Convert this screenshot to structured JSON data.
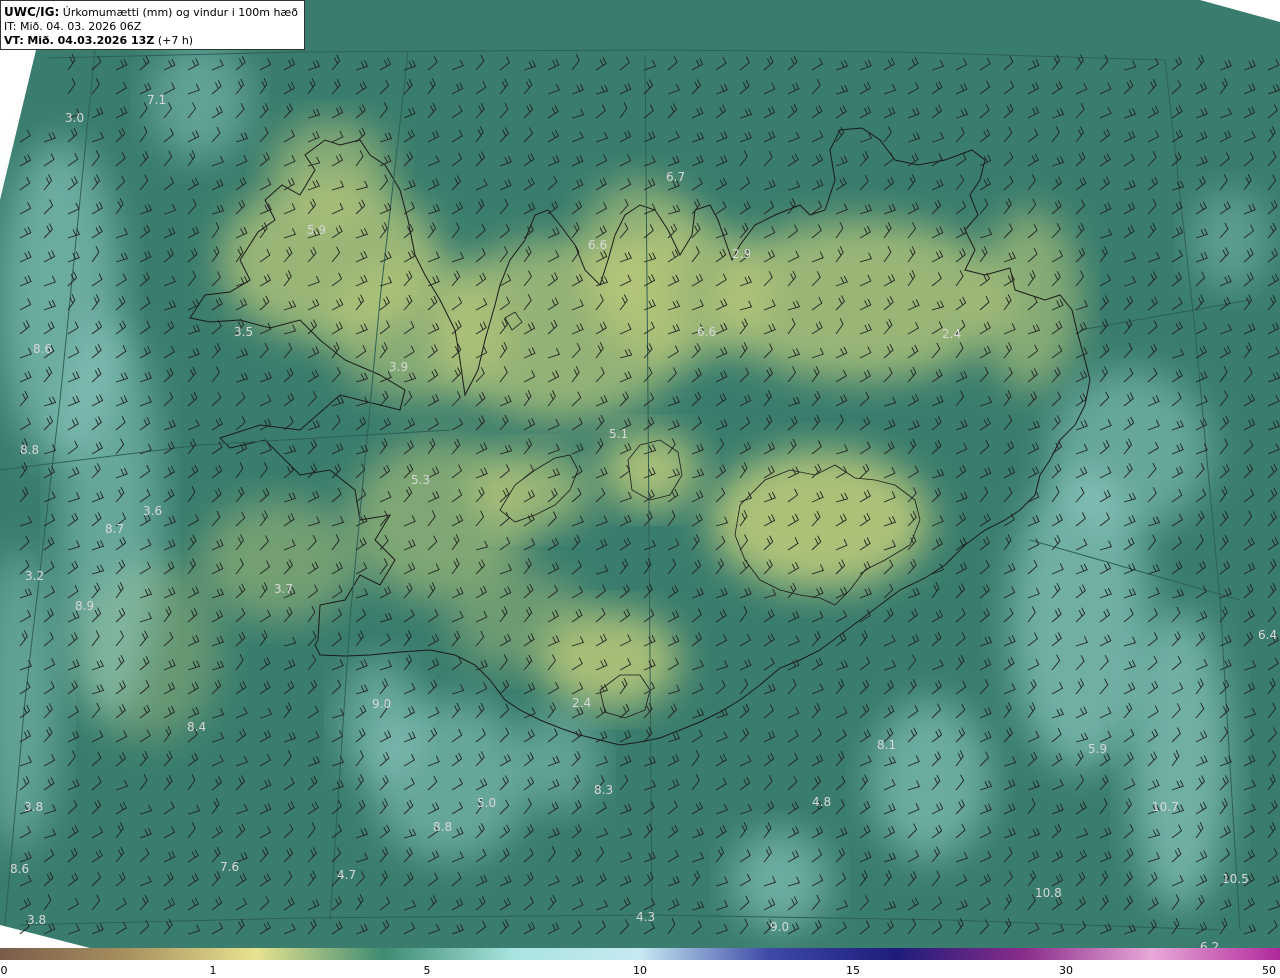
{
  "title": {
    "product": "UWC/IG:",
    "description": "Úrkomumætti (mm) og vindur i 100m hæð",
    "it_line": "IT: Mið. 04. 03. 2026 06Z",
    "vt_label": "VT:",
    "vt_value": "Mið. 04.03.2026 13Z",
    "vt_offset": "(+7 h)"
  },
  "colors": {
    "ocean_base": "#3a7d6e",
    "land_yellow": "#b9c97a",
    "light_cyan": "#9fd9d3",
    "coastline": "#1a1a1a"
  },
  "value_labels": [
    {
      "text": "7.1"
    },
    {
      "text": "3.0"
    },
    {
      "text": "6.7"
    },
    {
      "text": "5.9"
    },
    {
      "text": "6.6"
    },
    {
      "text": "2.9"
    },
    {
      "text": "3.5"
    },
    {
      "text": "8.6"
    },
    {
      "text": "6.6"
    },
    {
      "text": "2.4"
    },
    {
      "text": "3.9"
    },
    {
      "text": "5.1"
    },
    {
      "text": "8.8"
    },
    {
      "text": "5.3"
    },
    {
      "text": "3.6"
    },
    {
      "text": "8.7"
    },
    {
      "text": "3.2"
    },
    {
      "text": "3.7"
    },
    {
      "text": "8.9"
    },
    {
      "text": "6.4"
    },
    {
      "text": "9.0"
    },
    {
      "text": "8.4"
    },
    {
      "text": "2.4"
    },
    {
      "text": "5.9"
    },
    {
      "text": "8.1"
    },
    {
      "text": "3.8"
    },
    {
      "text": "5.0"
    },
    {
      "text": "8.3"
    },
    {
      "text": "4.8"
    },
    {
      "text": "10.7"
    },
    {
      "text": "8.8"
    },
    {
      "text": "8.6"
    },
    {
      "text": "7.6"
    },
    {
      "text": "4.7"
    },
    {
      "text": "10.8"
    },
    {
      "text": "10.5"
    },
    {
      "text": "3.8"
    },
    {
      "text": "4.3"
    },
    {
      "text": "9.0"
    },
    {
      "text": "6.2"
    }
  ],
  "colorbar": {
    "ticks": [
      "0",
      "1",
      "5",
      "10",
      "15",
      "30",
      "50"
    ],
    "colors": [
      "#7a5c4a",
      "#a8915f",
      "#e7e38f",
      "#3d8b72",
      "#a9e4df",
      "#c6e9f2",
      "#3f4aa8",
      "#1d1c7a",
      "#8a2c8a",
      "#e8a8d8",
      "#b0289a"
    ]
  }
}
